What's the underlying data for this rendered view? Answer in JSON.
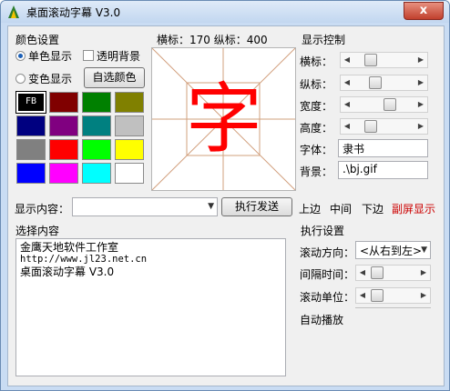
{
  "window": {
    "title": "桌面滚动字幕 V3.0",
    "close": "x"
  },
  "color_settings": {
    "title": "颜色设置",
    "mono": "单色显示",
    "transparent": "透明背景",
    "multi": "变色显示",
    "custom_btn": "自选颜色",
    "fb_label": "FB",
    "swatches": [
      "#000000",
      "#800000",
      "#008000",
      "#808000",
      "#000080",
      "#800080",
      "#008080",
      "#c0c0c0",
      "#808080",
      "#ff0000",
      "#00ff00",
      "#ffff00",
      "#0000ff",
      "#ff00ff",
      "#00ffff",
      "#ffffff"
    ]
  },
  "preview": {
    "coords": "横标：170 纵标：400",
    "char": "字",
    "char_color": "#ff0000"
  },
  "display_control": {
    "title": "显示控制",
    "h_label": "横标：",
    "v_label": "纵标：",
    "w_label": "宽度：",
    "height_label": "高度：",
    "font_label": "字体：",
    "font_value": "隶书",
    "bg_label": "背景：",
    "bg_value": ".\\bj.gif",
    "levels": {
      "h": 0.22,
      "v": 0.33,
      "w": 0.63,
      "height": 0.22
    }
  },
  "content_row": {
    "label": "显示内容：",
    "combo_value": "",
    "send_btn": "执行发送",
    "up": "上边",
    "mid": "中间",
    "down": "下边",
    "sub": "副屏显示"
  },
  "choose": {
    "title": "选择内容",
    "lines": [
      "金鹰天地软件工作室",
      "http://www.jl23.net.cn",
      "桌面滚动字幕 V3.0"
    ]
  },
  "exec": {
    "title": "执行设置",
    "dir_label": "滚动方向：",
    "dir_value": "<从右到左>",
    "interval_label": "间隔时间：",
    "unit_label": "滚动单位：",
    "auto": "自动播放",
    "levels": {
      "interval": 0.05,
      "unit": 0.05
    }
  }
}
